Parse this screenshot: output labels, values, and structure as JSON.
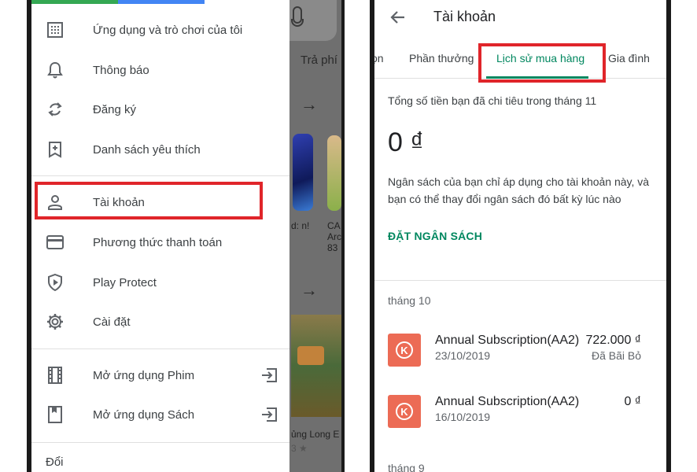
{
  "left_drawer": {
    "brand_colors": [
      "#4285f4",
      "#34a853",
      "#fbbc04",
      "#ea4335"
    ],
    "items": [
      {
        "label": "Ứng dụng và trò chơi của tôi",
        "icon": "apps-grid-icon"
      },
      {
        "label": "Thông báo",
        "icon": "bell-icon"
      },
      {
        "label": "Đăng ký",
        "icon": "refresh-icon"
      },
      {
        "label": "Danh sách yêu thích",
        "icon": "bookmark-add-icon"
      },
      {
        "label": "Tài khoản",
        "icon": "person-icon"
      },
      {
        "label": "Phương thức thanh toán",
        "icon": "credit-card-icon"
      },
      {
        "label": "Play Protect",
        "icon": "shield-play-icon"
      },
      {
        "label": "Cài đặt",
        "icon": "gear-icon"
      },
      {
        "label": "Mở ứng dụng Phim",
        "icon": "film-icon"
      },
      {
        "label": "Mở ứng dụng Sách",
        "icon": "book-icon"
      },
      {
        "label": "Đổi"
      }
    ],
    "highlight_color": "#e0252a"
  },
  "background_app": {
    "tab_partial": "Trả phí",
    "app_card_text_1": "d: n!",
    "app_card_text_2": "CA Arc 83",
    "game_label": "ủng Long E",
    "rating_partial": "3 ★"
  },
  "account_screen": {
    "title": "Tài khoản",
    "tabs": [
      {
        "label": "ọn"
      },
      {
        "label": "Phần thưởng"
      },
      {
        "label": "Lịch sử mua hàng",
        "active": true
      },
      {
        "label": "Gia đình"
      }
    ],
    "accent_color": "#01875f",
    "spending_label": "Tổng số tiền bạn đã chi tiêu trong tháng 11",
    "spending_amount": "0 ₫",
    "budget_description": "Ngân sách của bạn chỉ áp dụng cho tài khoản này, và bạn có thể thay đổi ngân sách đó bất kỳ lúc nào",
    "set_budget_label": "ĐẶT NGÂN SÁCH",
    "months": [
      {
        "label": "tháng 10",
        "transactions": [
          {
            "name": "Annual Subscription(AA2)",
            "date": "23/10/2019",
            "amount": "722.000 ₫",
            "status": "Đã Bãi Bỏ"
          },
          {
            "name": "Annual Subscription(AA2)",
            "date": "16/10/2019",
            "amount": "0 ₫",
            "status": ""
          }
        ]
      },
      {
        "label": "tháng 9"
      }
    ]
  }
}
